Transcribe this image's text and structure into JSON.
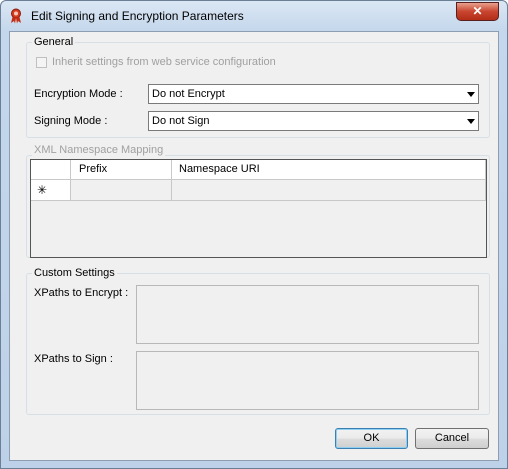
{
  "window": {
    "title": "Edit Signing and Encryption Parameters",
    "close_glyph": "✕",
    "icon": "seal-ribbon-icon"
  },
  "general": {
    "legend": "General",
    "inherit_label": "Inherit settings from web service configuration",
    "inherit_checked": false,
    "encryption_label": "Encryption Mode :",
    "encryption_value": "Do not Encrypt",
    "signing_label": "Signing Mode :",
    "signing_value": "Do not Sign"
  },
  "namespace": {
    "legend": "XML Namespace Mapping",
    "columns": [
      "Prefix",
      "Namespace URI"
    ],
    "new_row_marker": "✳"
  },
  "custom": {
    "legend": "Custom Settings",
    "encrypt_label": "XPaths to Encrypt :",
    "sign_label": "XPaths to Sign :"
  },
  "buttons": {
    "ok": "OK",
    "cancel": "Cancel"
  }
}
